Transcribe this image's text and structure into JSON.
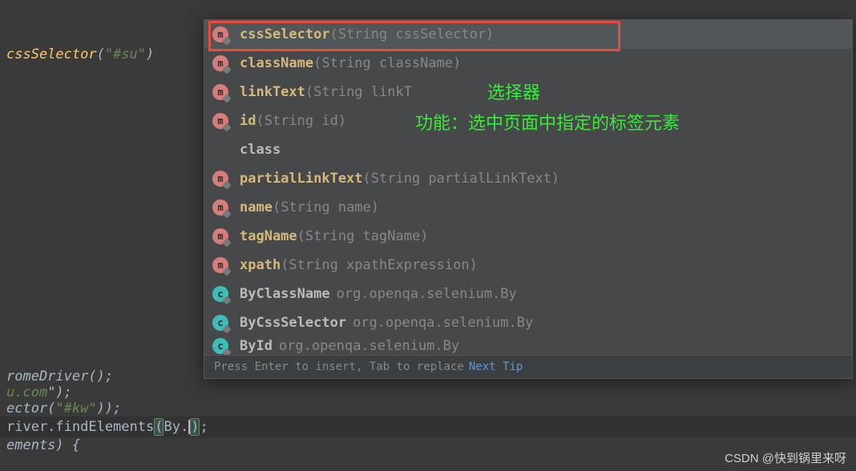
{
  "code": {
    "line1_method": "cssSelector",
    "line1_string": "\"#su\"",
    "bottom1": "romeDriver();",
    "bottom2a": "u.com",
    "bottom2b": "\");",
    "bottom3a": "ector(",
    "bottom3b": "\"#kw\"",
    "bottom3c": "));",
    "bottom4a": "river.findElements",
    "bottom4b": "(",
    "bottom4c": "By.",
    "bottom4d": ")",
    "bottom4e": ";",
    "bottom5": "ements) {"
  },
  "completion": {
    "items": [
      {
        "icon": "m",
        "name": "cssSelector",
        "params": "(String cssSelector)",
        "selected": true
      },
      {
        "icon": "m",
        "name": "className",
        "params": "(String className)"
      },
      {
        "icon": "m",
        "name": "linkText",
        "params": "(String linkT"
      },
      {
        "icon": "m",
        "name": "id",
        "params": "(String id)"
      },
      {
        "icon": "",
        "name": "class",
        "params": ""
      },
      {
        "icon": "m",
        "name": "partialLinkText",
        "params": "(String partialLinkText)"
      },
      {
        "icon": "m",
        "name": "name",
        "params": "(String name)"
      },
      {
        "icon": "m",
        "name": "tagName",
        "params": "(String tagName)"
      },
      {
        "icon": "m",
        "name": "xpath",
        "params": "(String xpathExpression)"
      },
      {
        "icon": "c",
        "name": "ByClassName",
        "pkg": "org.openqa.selenium.By"
      },
      {
        "icon": "c",
        "name": "ByCssSelector",
        "pkg": "org.openqa.selenium.By"
      },
      {
        "icon": "c",
        "name": "ById",
        "pkg": "org.openqa.selenium.By",
        "truncated": true
      }
    ],
    "footer_text": "Press Enter to insert, Tab to replace",
    "footer_link": "Next Tip"
  },
  "annotations": {
    "title": "选择器",
    "desc": "功能：选中页面中指定的标签元素"
  },
  "watermark": "CSDN @快到锅里来呀"
}
